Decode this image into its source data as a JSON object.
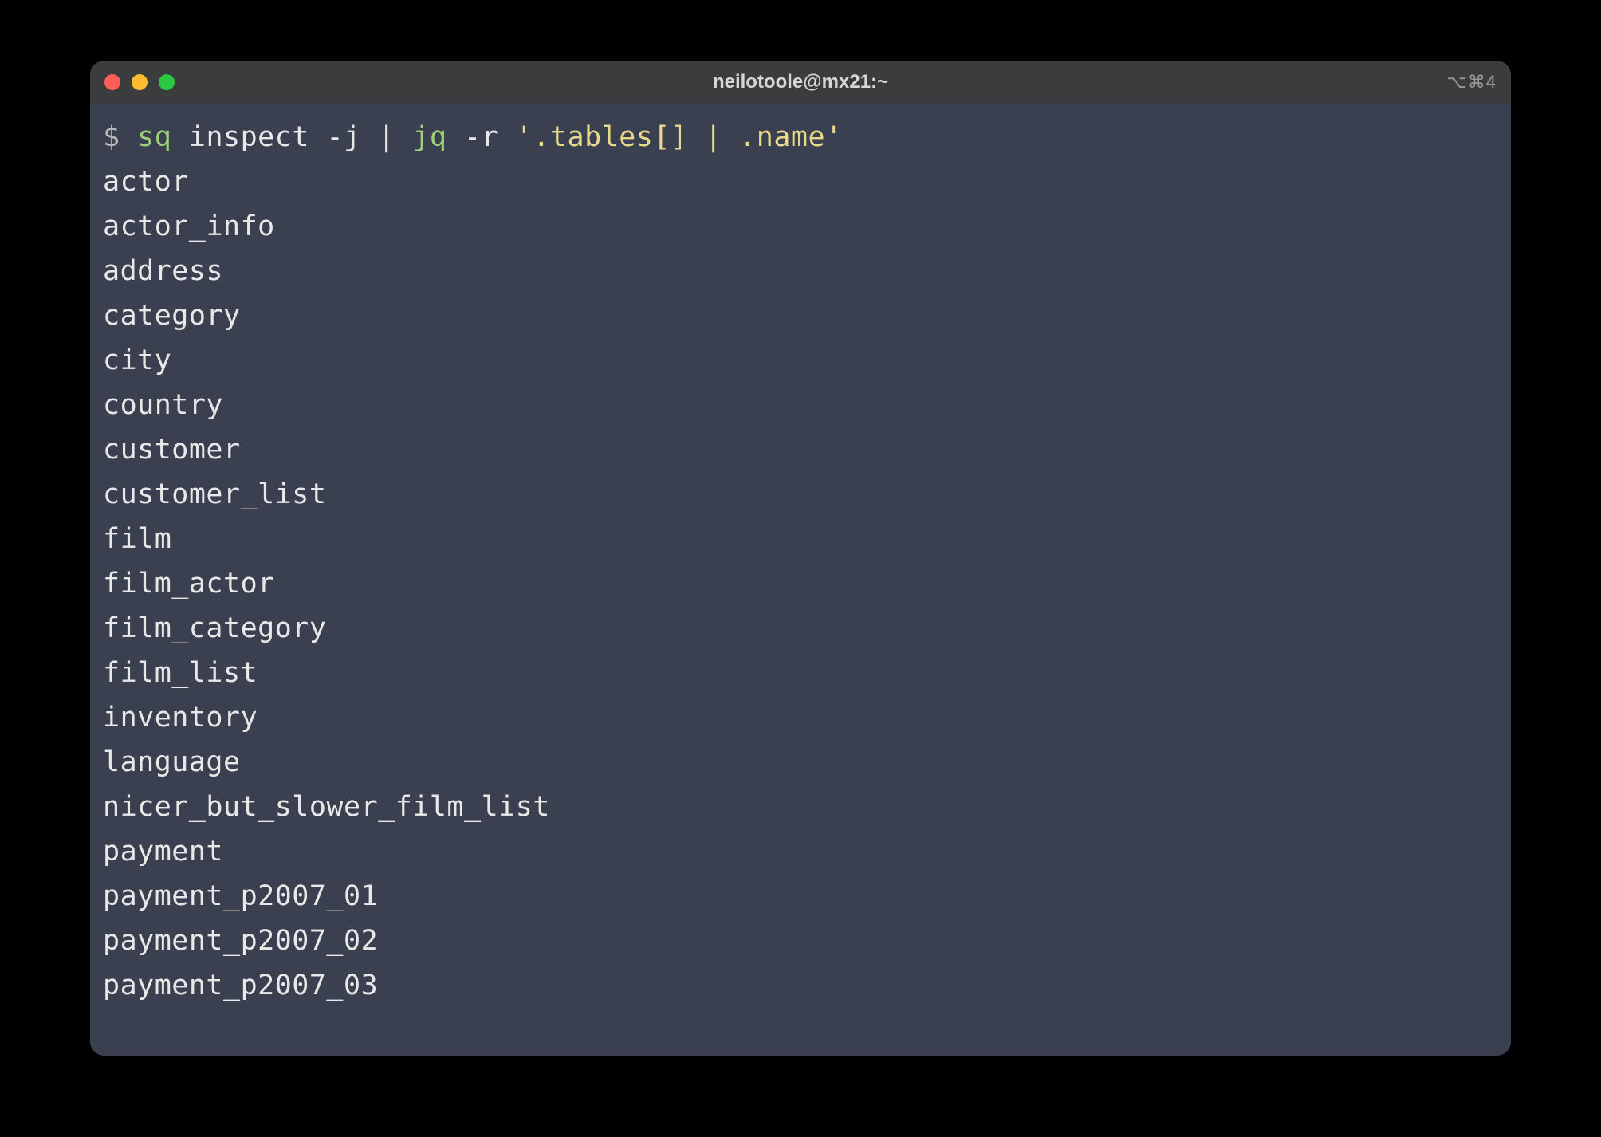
{
  "window": {
    "title": "neilotoole@mx21:~",
    "shortcut_hint": "⌥⌘4"
  },
  "prompt": {
    "symbol": "$",
    "cmd_part1": "sq",
    "cmd_part2": " inspect -j | ",
    "cmd_part3": "jq",
    "cmd_part4": " -r ",
    "cmd_string": "'.tables[] | .name'"
  },
  "output": [
    "actor",
    "actor_info",
    "address",
    "category",
    "city",
    "country",
    "customer",
    "customer_list",
    "film",
    "film_actor",
    "film_category",
    "film_list",
    "inventory",
    "language",
    "nicer_but_slower_film_list",
    "payment",
    "payment_p2007_01",
    "payment_p2007_02",
    "payment_p2007_03"
  ]
}
